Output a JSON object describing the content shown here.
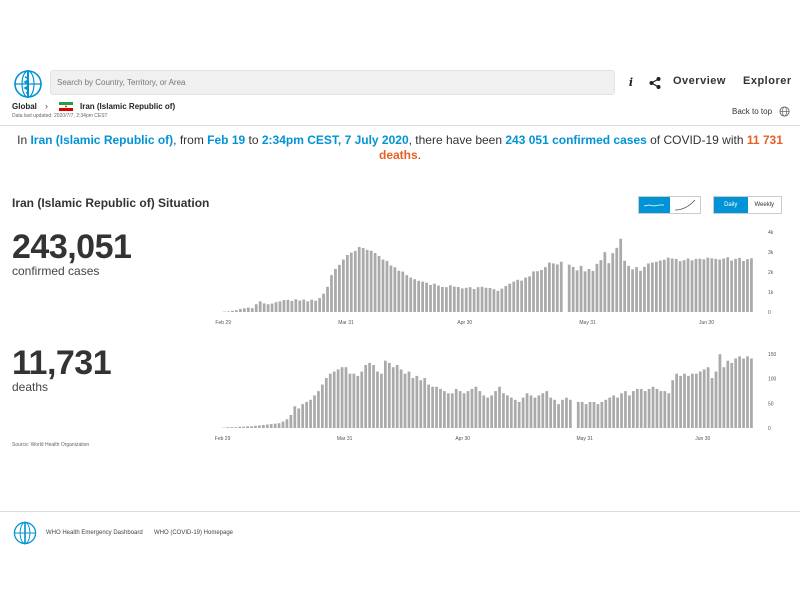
{
  "header": {
    "search_placeholder": "Search by Country, Territory, or Area",
    "nav": {
      "overview": "Overview",
      "explorer": "Explorer"
    },
    "icons": [
      "who-logo-icon",
      "info-icon",
      "share-icon"
    ]
  },
  "breadcrumb": {
    "global": "Global",
    "separator": "›",
    "country": "Iran (Islamic Republic of)",
    "updated": "Data last updated: 2020/7/7, 2:34pm CEST",
    "back_to_top": "Back to top"
  },
  "headline": {
    "p1": "In ",
    "country": "Iran (Islamic Republic of)",
    "p2": ", from ",
    "from": "Feb 19",
    "p3": " to ",
    "to": "2:34pm CEST, 7 July 2020",
    "p4": ", there have been ",
    "cases": "243 051 confirmed cases",
    "p5": " of COVID-19 with ",
    "deaths": "11 731 deaths",
    "p6": "."
  },
  "situation": {
    "title": "Iran (Islamic Republic of) Situation",
    "period_daily": "Daily",
    "period_weekly": "Weekly",
    "cases_total": "243,051",
    "cases_label": "confirmed cases",
    "deaths_total": "11,731",
    "deaths_label": "deaths",
    "source": "Source: World Health Organization"
  },
  "colors": {
    "accent": "#0093d5",
    "orange": "#e85f26",
    "bar": "#aaaaaa"
  },
  "chart_data": [
    {
      "type": "bar",
      "series": [
        {
          "name": "confirmed cases",
          "values": [
            0,
            0,
            0,
            0,
            0,
            0,
            0,
            0,
            0,
            0,
            0,
            0,
            0,
            0,
            0,
            0,
            0,
            0,
            0,
            0,
            0,
            0,
            20,
            30,
            60,
            90,
            150,
            180,
            220,
            190,
            380,
            520,
            420,
            380,
            410,
            480,
            520,
            580,
            590,
            540,
            620,
            560,
            610,
            520,
            600,
            550,
            680,
            890,
            1230,
            1800,
            2100,
            2300,
            2560,
            2780,
            2900,
            2980,
            3170,
            3120,
            3030,
            2990,
            2880,
            2730,
            2560,
            2490,
            2270,
            2180,
            2010,
            1970,
            1800,
            1680,
            1600,
            1520,
            1480,
            1430,
            1320,
            1380,
            1290,
            1220,
            1210,
            1300,
            1240,
            1220,
            1150,
            1180,
            1210,
            1120,
            1210,
            1230,
            1180,
            1170,
            1110,
            1030,
            1140,
            1270,
            1380,
            1480,
            1570,
            1530,
            1680,
            1740,
            1980,
            1990,
            2050,
            2190,
            2410,
            2370,
            2320,
            2450,
            0,
            2310,
            2200,
            2030,
            2250,
            1980,
            2100,
            2000,
            2350,
            2530,
            2920,
            2380,
            2870,
            3130,
            3570,
            2500,
            2250,
            2080,
            2190,
            2010,
            2200,
            2370,
            2410,
            2450,
            2510,
            2550,
            2650,
            2610,
            2590,
            2480,
            2530,
            2610,
            2520,
            2590,
            2600,
            2570,
            2650,
            2620,
            2590,
            2560,
            2610,
            2670,
            2510,
            2590,
            2640,
            2490,
            2580,
            2620
          ]
        }
      ],
      "x_tick_labels": [
        "Feb 29",
        "Mar 31",
        "Apr 30",
        "May 31",
        "Jun 30"
      ],
      "y_tick_labels": [
        "0",
        "1k",
        "2k",
        "3k",
        "4k"
      ],
      "ylim": [
        0,
        4000
      ]
    },
    {
      "type": "bar",
      "series": [
        {
          "name": "deaths",
          "values": [
            0,
            0,
            0,
            0,
            0,
            0,
            0,
            0,
            0,
            0,
            0,
            0,
            0,
            0,
            0,
            0,
            0,
            0,
            0,
            0,
            0,
            0,
            1,
            2,
            2,
            2,
            3,
            3,
            4,
            4,
            5,
            6,
            7,
            8,
            9,
            10,
            11,
            15,
            20,
            30,
            50,
            45,
            55,
            60,
            65,
            75,
            85,
            100,
            115,
            125,
            130,
            135,
            140,
            140,
            125,
            125,
            120,
            130,
            145,
            150,
            145,
            130,
            125,
            155,
            150,
            140,
            145,
            135,
            125,
            130,
            115,
            120,
            110,
            115,
            100,
            95,
            95,
            90,
            85,
            80,
            80,
            90,
            85,
            80,
            85,
            90,
            95,
            85,
            75,
            70,
            75,
            85,
            95,
            80,
            75,
            70,
            65,
            60,
            70,
            80,
            75,
            70,
            75,
            80,
            85,
            70,
            65,
            55,
            65,
            70,
            65,
            0,
            60,
            60,
            55,
            60,
            60,
            55,
            60,
            65,
            70,
            75,
            70,
            80,
            85,
            75,
            85,
            90,
            90,
            85,
            90,
            95,
            90,
            85,
            85,
            80,
            110,
            125,
            120,
            125,
            120,
            125,
            125,
            130,
            135,
            140,
            115,
            130,
            170,
            140,
            155,
            150,
            160,
            165,
            160,
            165,
            160
          ]
        }
      ],
      "x_tick_labels": [
        "Feb 29",
        "Mar 31",
        "Apr 30",
        "May 31",
        "Jun 30"
      ],
      "y_tick_labels": [
        "0",
        "50",
        "100",
        "150"
      ],
      "ylim": [
        0,
        175
      ]
    }
  ],
  "footer": {
    "link1": "WHO Health Emergency Dashboard",
    "link2": "WHO (COVID-19) Homepage"
  }
}
